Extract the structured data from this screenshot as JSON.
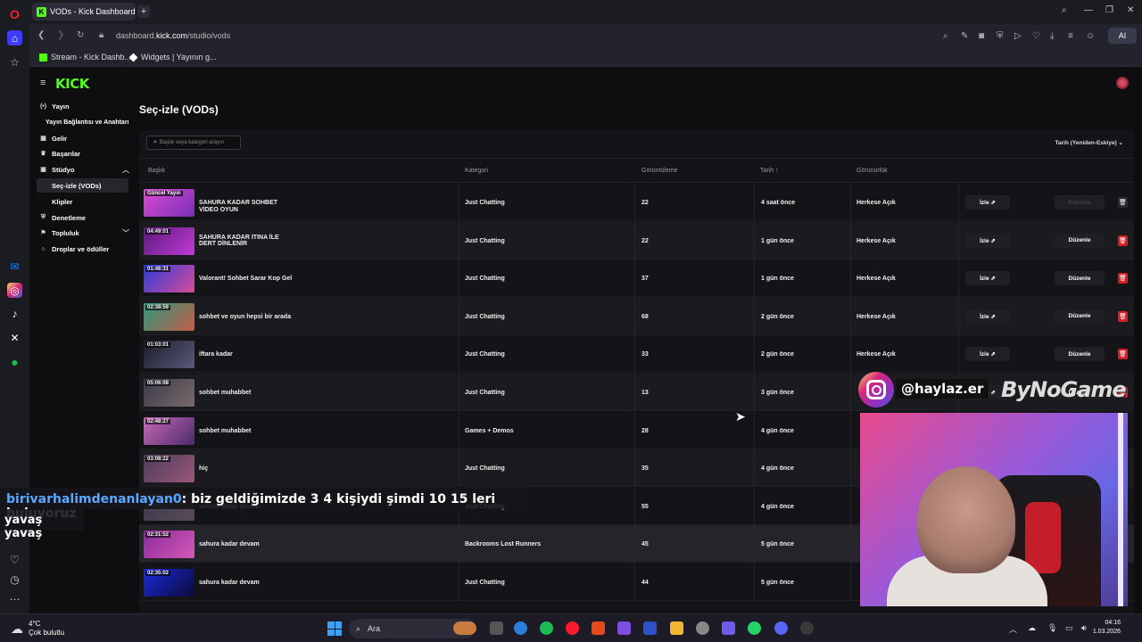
{
  "browser": {
    "tab_title": "VODs - Kick Dashboard",
    "url_prefix": "dashboard.",
    "url_domain": "kick.com",
    "url_path": "/studio/vods",
    "ai_label": "AI",
    "bookmarks": [
      "Stream - Kick Dashb...",
      "Widgets | Yayının g..."
    ]
  },
  "sidebar": {
    "logo": "KICK",
    "items": [
      {
        "label": "Yayın",
        "icon": "broadcast-icon"
      },
      {
        "label": "Yayın Bağlantısı ve Anahtarı",
        "icon": ""
      },
      {
        "label": "Gelir",
        "icon": "revenue-icon"
      },
      {
        "label": "Başarılar",
        "icon": "trophy-icon"
      },
      {
        "label": "Stüdyo",
        "icon": "studio-icon"
      },
      {
        "label": "Seç-izle (VODs)",
        "icon": ""
      },
      {
        "label": "Klipler",
        "icon": ""
      },
      {
        "label": "Denetleme",
        "icon": "shield-icon"
      },
      {
        "label": "Topluluk",
        "icon": "community-icon"
      },
      {
        "label": "Droplar ve ödüller",
        "icon": "gift-icon"
      }
    ]
  },
  "main": {
    "page_title": "Seç-izle (VODs)",
    "search_placeholder": "Başlık veya kategori arayın",
    "sort_label": "Tarih (Yeniden-Eskiye)",
    "columns": [
      "Başlık",
      "Kategori",
      "Görüntüleme",
      "Tarih ↑",
      "Görünürlük"
    ],
    "watch_label": "İzle ⇗",
    "edit_label": "Düzenle",
    "rows": [
      {
        "duration": "Güncel Yayın",
        "title": "SAHURA KADAR SOHBET VİDEO OYUN",
        "category": "Just Chatting",
        "views": "22",
        "date": "4 saat önce",
        "visibility": "Herkese Açık"
      },
      {
        "duration": "04:49:01",
        "title": "SAHURA KADAR ITINA İLE DERT DİNLENİR",
        "category": "Just Chatting",
        "views": "22",
        "date": "1 gün önce",
        "visibility": "Herkese Açık"
      },
      {
        "duration": "01:46:31",
        "title": "Valorant! Sohbet Sarar Kop Gel",
        "category": "Just Chatting",
        "views": "37",
        "date": "1 gün önce",
        "visibility": "Herkese Açık"
      },
      {
        "duration": "02:38:59",
        "title": "sohbet ve oyun hepsi bir arada",
        "category": "Just Chatting",
        "views": "68",
        "date": "2 gün önce",
        "visibility": "Herkese Açık"
      },
      {
        "duration": "01:03:01",
        "title": "iftara kadar",
        "category": "Just Chatting",
        "views": "33",
        "date": "2 gün önce",
        "visibility": "Herkese Açık"
      },
      {
        "duration": "05:06:08",
        "title": "sohbet muhabbet",
        "category": "Just Chatting",
        "views": "13",
        "date": "3 gün önce",
        "visibility": ""
      },
      {
        "duration": "02:48:27",
        "title": "sohbet muhabbet",
        "category": "Games + Demos",
        "views": "28",
        "date": "4 gün önce",
        "visibility": ""
      },
      {
        "duration": "03:08:22",
        "title": "hiç",
        "category": "Just Chatting",
        "views": "35",
        "date": "4 gün önce",
        "visibility": ""
      },
      {
        "duration": "",
        "title": "sahura kadar devam",
        "category": "Just Chatting",
        "views": "55",
        "date": "4 gün önce",
        "visibility": ""
      },
      {
        "duration": "02:31:52",
        "title": "sahura kadar devam",
        "category": "Backrooms Lost Runners",
        "views": "45",
        "date": "5 gün önce",
        "visibility": ""
      },
      {
        "duration": "02:35:02",
        "title": "sahura kadar devam",
        "category": "Just Chatting",
        "views": "44",
        "date": "5 gün önce",
        "visibility": ""
      }
    ]
  },
  "overlay": {
    "instagram_handle": "@haylaz.er",
    "sponsor": "ByNoGame",
    "chat_user": "birivarhalimdenanlayan0",
    "chat_message": ": biz geldiğimizde 3 4 kişiydi şimdi 10 15 leri buluyoruz",
    "chat_message_2": "yavaş yavaş"
  },
  "taskbar": {
    "temperature": "4°C",
    "weather": "Çok bulutlu",
    "search_label": "Ara",
    "time": "04:16",
    "date": "1.03.2026"
  }
}
